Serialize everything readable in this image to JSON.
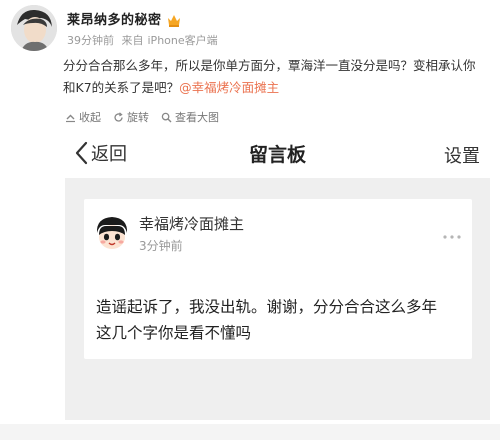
{
  "post": {
    "author": "莱昂纳多的秘密",
    "time": "39分钟前",
    "source_prefix": "来自",
    "source": "iPhone客户端",
    "text": "分分合合那么多年，所以是你单方面分，覃海洋一直没分是吗？变相承认你和K7的关系了是吧？",
    "mention": "@幸福烤冷面摊主"
  },
  "toolbar": {
    "collapse": "收起",
    "rotate": "旋转",
    "view_large": "查看大图"
  },
  "screenshot": {
    "back_label": "返回",
    "title": "留言板",
    "settings": "设置",
    "card": {
      "name": "幸福烤冷面摊主",
      "time": "3分钟前",
      "line1": "造谣起诉了，我没出轨。谢谢，分分合合这么多年",
      "line2": "这几个字你是看不懂吗"
    }
  },
  "colors": {
    "mention": "#eb7350",
    "meta": "#9a9a9a",
    "panel_bg": "#efefef"
  },
  "icons": [
    "crown-icon",
    "collapse-icon",
    "rotate-icon",
    "view-large-icon",
    "back-chevron-icon",
    "more-icon"
  ]
}
